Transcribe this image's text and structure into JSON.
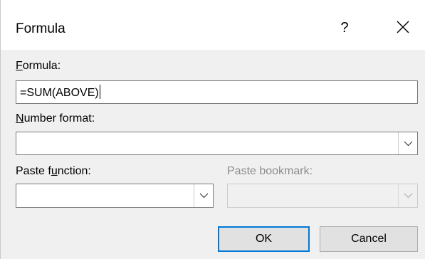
{
  "dialog": {
    "title": "Formula",
    "help_label": "?",
    "close_icon": "close-icon"
  },
  "formula": {
    "label_hotkey": "F",
    "label_rest": "ormula:",
    "value": "=SUM(ABOVE)"
  },
  "number_format": {
    "label_hotkey": "N",
    "label_rest": "umber format:",
    "value": ""
  },
  "paste_function": {
    "label_pre": "Paste f",
    "label_hotkey": "u",
    "label_post": "nction:",
    "value": ""
  },
  "paste_bookmark": {
    "label": "Paste bookmark:",
    "value": "",
    "enabled": false
  },
  "buttons": {
    "ok": "OK",
    "cancel": "Cancel"
  },
  "colors": {
    "accent": "#0078d7",
    "dialog_bg": "#f0f0f0",
    "disabled_text": "#8c8c8c"
  }
}
